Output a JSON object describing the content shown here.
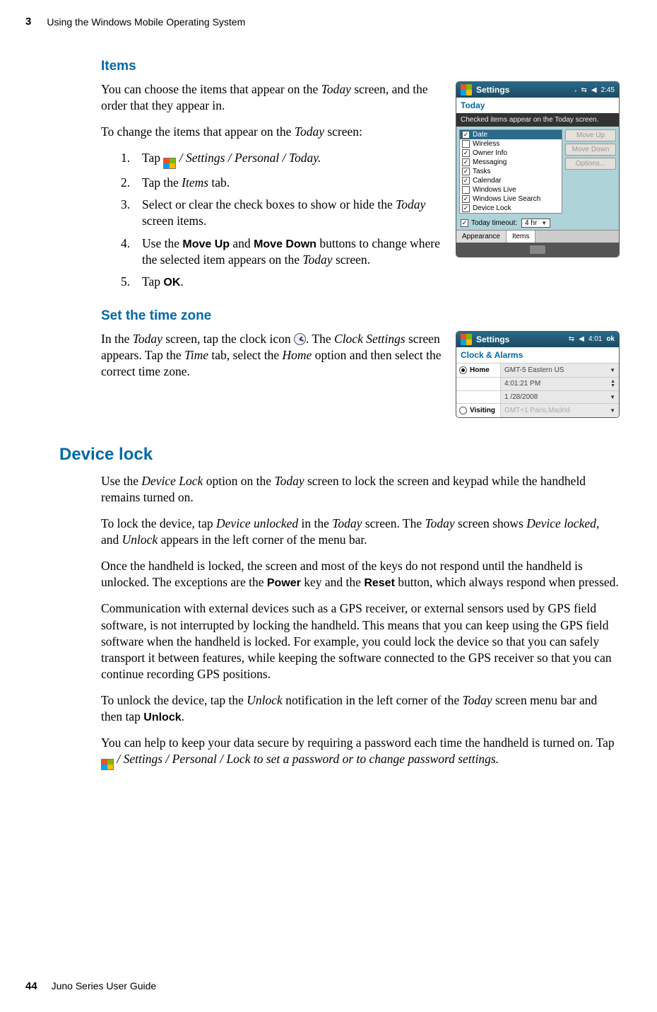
{
  "header": {
    "chapter_num": "3",
    "chapter_title": "Using the Windows Mobile Operating System"
  },
  "s1": {
    "heading": "Items",
    "p1": "You can choose the items that appear on the Today screen, and the order that they appear in.",
    "p2": "To change the items that appear on the Today screen:",
    "steps": {
      "n1": "1.",
      "t1a": "Tap ",
      "t1b": " / Settings / Personal / Today.",
      "n2": "2.",
      "t2": "Tap the Items tab.",
      "n3": "3.",
      "t3": "Select or clear the check boxes to show or hide the Today screen items.",
      "n4": "4.",
      "t4": "Use the Move Up and Move Down buttons to change where the selected item appears on the Today screen.",
      "n5": "5.",
      "t5a": "Tap ",
      "t5b": "OK",
      "t5c": "."
    }
  },
  "s2": {
    "heading": "Set the time zone",
    "p1a": "In the Today screen, tap the clock icon ",
    "p1b": ". The Clock Settings screen appears. Tap the Time tab, select the Home option and then select the correct time zone."
  },
  "s3": {
    "heading": "Device lock",
    "p1": "Use the Device Lock option on the Today screen to lock the screen and keypad while the handheld remains turned on.",
    "p2": "To lock the device, tap Device unlocked in the Today screen. The Today screen shows Device locked, and Unlock appears in the left corner of the menu bar.",
    "p3": "Once the handheld is locked, the screen and most of the keys do not respond until the handheld is unlocked. The exceptions are the Power key and the Reset button, which always respond when pressed.",
    "p4": "Communication with external devices such as a GPS receiver, or external sensors used by GPS field software, is not interrupted by locking the handheld. This means that you can keep using the GPS field software when the handheld is locked. For example, you could lock the device so that you can safely transport it between features, while keeping the software connected to the GPS receiver so that you can continue recording GPS positions.",
    "p5": "To unlock the device, tap the Unlock notification in the left corner of the Today screen menu bar and then tap Unlock.",
    "p6a": "You can help to keep your data secure by requiring a password each time the handheld is turned on. Tap ",
    "p6b": " / Settings / Personal / Lock to set a password or to change password settings."
  },
  "shot1": {
    "title": "Settings",
    "time": "2:45",
    "sub": "Today",
    "hint": "Checked items appear on the Today screen.",
    "items": [
      {
        "label": "Date",
        "checked": true,
        "sel": true
      },
      {
        "label": "Wireless",
        "checked": false
      },
      {
        "label": "Owner Info",
        "checked": true
      },
      {
        "label": "Messaging",
        "checked": true
      },
      {
        "label": "Tasks",
        "checked": true
      },
      {
        "label": "Calendar",
        "checked": true
      },
      {
        "label": "Windows Live",
        "checked": false
      },
      {
        "label": "Windows Live Search",
        "checked": true
      },
      {
        "label": "Device Lock",
        "checked": true
      }
    ],
    "btn_up": "Move Up",
    "btn_down": "Move Down",
    "btn_opts": "Options...",
    "timeout_label": "Today timeout:",
    "timeout_val": "4 hr",
    "tab1": "Appearance",
    "tab2": "Items"
  },
  "shot2": {
    "title": "Settings",
    "time": "4:01",
    "ok": "ok",
    "sub": "Clock & Alarms",
    "home": "Home",
    "visiting": "Visiting",
    "tz1": "GMT-5 Eastern US",
    "t1": "4:01:21 PM",
    "d1": "1 /28/2008",
    "tz2": "GMT+1 Paris,Madrid"
  },
  "footer": {
    "page": "44",
    "book": "Juno Series User Guide"
  }
}
